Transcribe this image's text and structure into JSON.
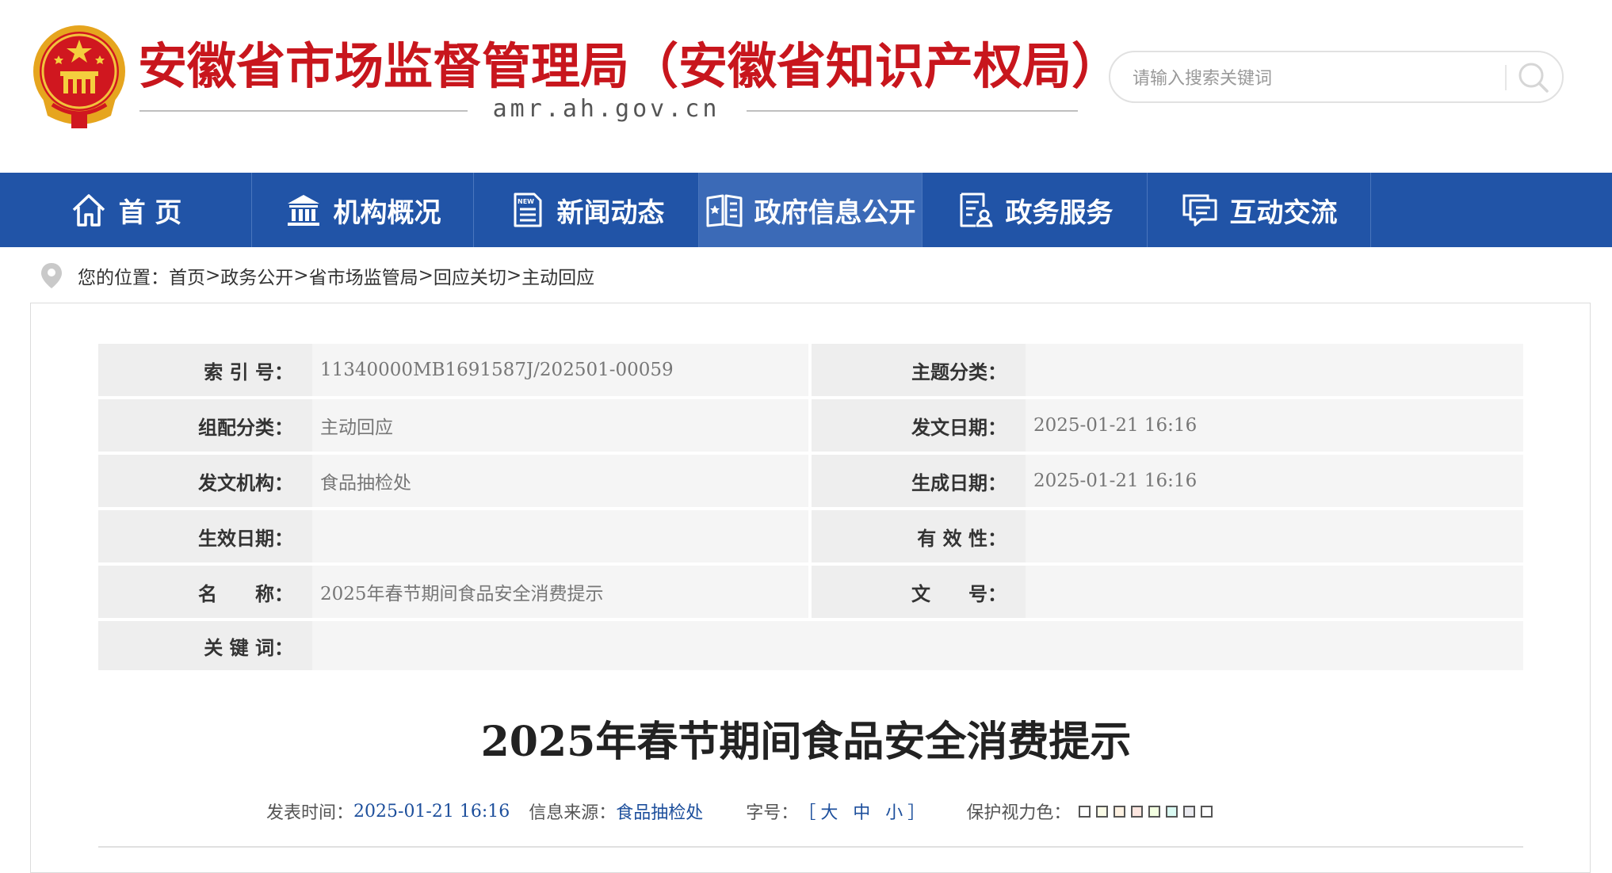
{
  "header": {
    "site_title": "安徽省市场监督管理局（安徽省知识产权局）",
    "domain": "amr.ah.gov.cn",
    "search_placeholder": "请输入搜索关键词"
  },
  "nav": {
    "items": [
      {
        "label": "首 页",
        "icon": "home-icon"
      },
      {
        "label": "机构概况",
        "icon": "building-icon"
      },
      {
        "label": "新闻动态",
        "icon": "news-icon"
      },
      {
        "label": "政府信息公开",
        "icon": "open-book-icon"
      },
      {
        "label": "政务服务",
        "icon": "service-icon"
      },
      {
        "label": "互动交流",
        "icon": "chat-icon"
      }
    ],
    "active_index": 3
  },
  "breadcrumb": {
    "prefix": "您的位置：",
    "items": [
      "首页",
      "政务公开",
      "省市场监管局",
      "回应关切",
      "主动回应"
    ],
    "separator": " > "
  },
  "meta": {
    "index_no_label": "索 引 号：",
    "index_no": "11340000MB1691587J/202501-00059",
    "topic_label": "主题分类：",
    "topic": "",
    "group_label": "组配分类：",
    "group": "主动回应",
    "issue_date_label": "发文日期：",
    "issue_date": "2025-01-21 16:16",
    "issuer_label": "发文机构：",
    "issuer": "食品抽检处",
    "created_label": "生成日期：",
    "created": "2025-01-21 16:16",
    "effective_label": "生效日期：",
    "effective": "",
    "validity_label": "有 效 性：",
    "validity": "",
    "name_label": "名　　称：",
    "name": "2025年春节期间食品安全消费提示",
    "doc_no_label": "文　　号：",
    "doc_no": "",
    "keywords_label": "关 键 词：",
    "keywords": ""
  },
  "article": {
    "title": "2025年春节期间食品安全消费提示",
    "publish_label": "发表时间：",
    "publish_time": "2025-01-21 16:16",
    "source_label": "信息来源：",
    "source": "食品抽检处",
    "font_size_label": "字号：",
    "font_size_options": "［大 中 小］",
    "eye_color_label": "保护视力色：",
    "eye_colors": [
      "#ffffff",
      "#fafbe6",
      "#fff2e2",
      "#fde6e0",
      "#f3ffe1",
      "#dafaf3",
      "#eaeaef",
      "#ffffff"
    ]
  },
  "colors": {
    "brand_red": "#c8161d",
    "nav_blue": "#2154a7",
    "nav_active": "#3b6ab7",
    "link_blue": "#1d4f9c"
  }
}
